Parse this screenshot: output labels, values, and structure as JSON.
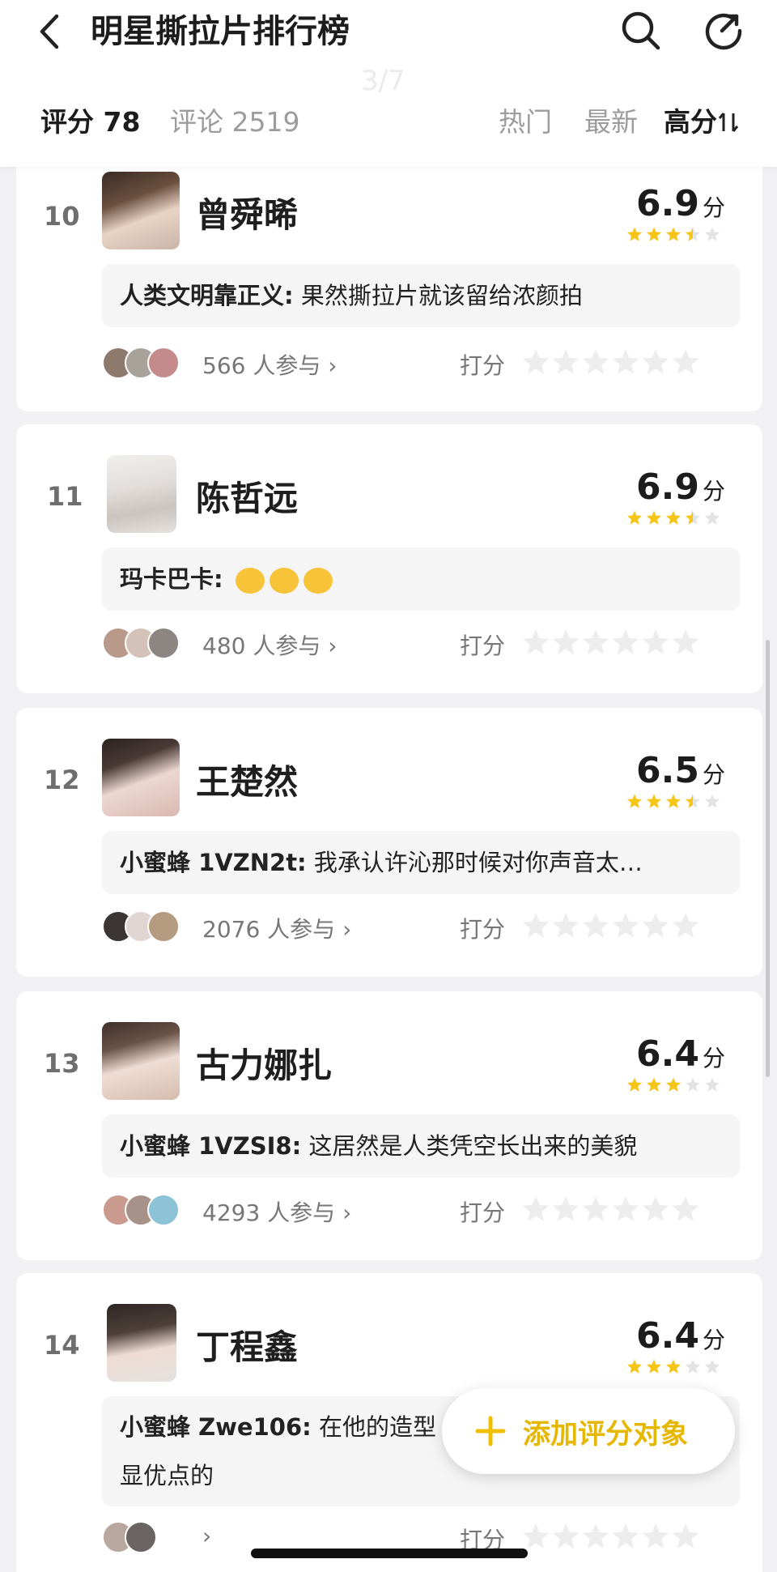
{
  "header": {
    "title": "明星撕拉片排行榜",
    "page_indicator": "3/7",
    "tab_score": "评分 78",
    "tab_comment": "评论 2519",
    "sort_hot": "热门",
    "sort_new": "最新",
    "sort_high": "高分"
  },
  "items": [
    {
      "rank": "10",
      "name": "曾舜晞",
      "score": "6.9",
      "unit": "分",
      "stars": 3.5,
      "comment_user": "人类文明靠正义:",
      "comment_text": "果然撕拉片就该留给浓颜拍",
      "participants": "566 人参与",
      "rate_label": "打分"
    },
    {
      "rank": "11",
      "name": "陈哲远",
      "score": "6.9",
      "unit": "分",
      "stars": 3.5,
      "comment_user": "玛卡巴卡:",
      "comment_text": "",
      "participants": "480 人参与",
      "rate_label": "打分"
    },
    {
      "rank": "12",
      "name": "王楚然",
      "score": "6.5",
      "unit": "分",
      "stars": 3.5,
      "comment_user": "小蜜蜂 1VZN2t:",
      "comment_text": "我承认许沁那时候对你声音太…",
      "participants": "2076 人参与",
      "rate_label": "打分"
    },
    {
      "rank": "13",
      "name": "古力娜扎",
      "score": "6.4",
      "unit": "分",
      "stars": 3,
      "comment_user": "小蜜蜂 1VZSI8:",
      "comment_text": "这居然是人类凭空长出来的美貌",
      "participants": "4293 人参与",
      "rate_label": "打分"
    },
    {
      "rank": "14",
      "name": "丁程鑫",
      "score": "6.4",
      "unit": "分",
      "stars": 3,
      "comment_user": "小蜜蜂 Zwe106:",
      "comment_text": "在他的造型",
      "comment_text2": "显优点的",
      "participants": "",
      "rate_label": "打分"
    }
  ],
  "fab": {
    "label": "添加评分对象"
  },
  "colors": {
    "accent": "#f5c518",
    "star_empty": "#e3e3e3",
    "rate_star_empty": "#ededed"
  }
}
